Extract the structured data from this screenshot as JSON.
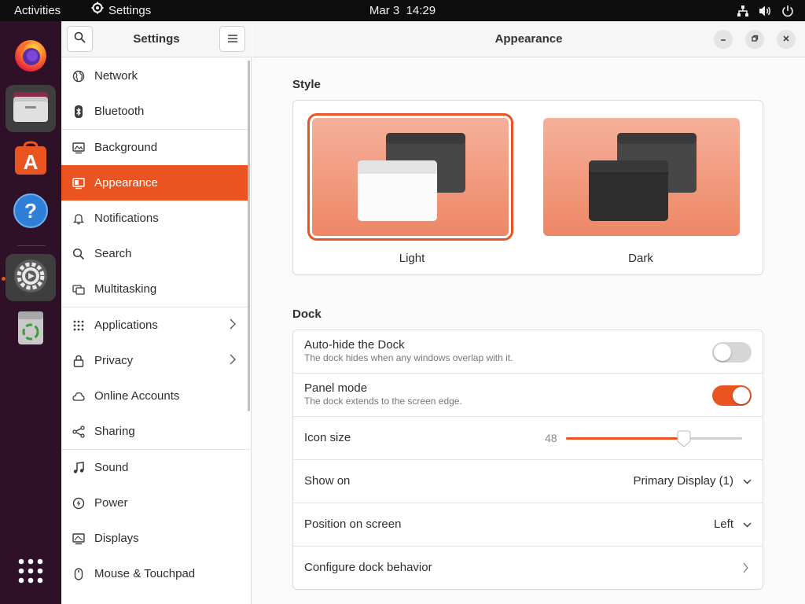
{
  "topbar": {
    "activities": "Activities",
    "app_name": "Settings",
    "date": "Mar 3",
    "time": "14:29"
  },
  "dock": {
    "items": [
      {
        "name": "Firefox Web Browser",
        "icon": "firefox-icon"
      },
      {
        "name": "Files",
        "icon": "files-icon"
      },
      {
        "name": "Ubuntu Software",
        "icon": "software-icon"
      },
      {
        "name": "Help",
        "icon": "help-icon"
      },
      {
        "name": "Settings",
        "icon": "settings-icon"
      },
      {
        "name": "Trash",
        "icon": "trash-icon"
      },
      {
        "name": "Show Applications",
        "icon": "app-grid-icon"
      }
    ]
  },
  "sidebar": {
    "title": "Settings",
    "items": [
      {
        "label": "Network",
        "icon": "globe-icon"
      },
      {
        "label": "Bluetooth",
        "icon": "bluetooth-icon"
      },
      {
        "label": "Background",
        "icon": "background-icon"
      },
      {
        "label": "Appearance",
        "icon": "appearance-icon",
        "selected": true
      },
      {
        "label": "Notifications",
        "icon": "bell-icon"
      },
      {
        "label": "Search",
        "icon": "search-icon"
      },
      {
        "label": "Multitasking",
        "icon": "multitasking-icon"
      },
      {
        "label": "Applications",
        "icon": "grid-icon",
        "has_submenu": true
      },
      {
        "label": "Privacy",
        "icon": "lock-icon",
        "has_submenu": true
      },
      {
        "label": "Online Accounts",
        "icon": "cloud-icon"
      },
      {
        "label": "Sharing",
        "icon": "share-icon"
      },
      {
        "label": "Sound",
        "icon": "music-note-icon"
      },
      {
        "label": "Power",
        "icon": "power-icon"
      },
      {
        "label": "Displays",
        "icon": "display-icon"
      },
      {
        "label": "Mouse & Touchpad",
        "icon": "mouse-icon"
      }
    ]
  },
  "main": {
    "title": "Appearance",
    "style": {
      "heading": "Style",
      "options": [
        {
          "label": "Light",
          "selected": true
        },
        {
          "label": "Dark",
          "selected": false
        }
      ]
    },
    "dock": {
      "heading": "Dock",
      "autohide": {
        "title": "Auto-hide the Dock",
        "subtitle": "The dock hides when any windows overlap with it.",
        "enabled": false
      },
      "panel_mode": {
        "title": "Panel mode",
        "subtitle": "The dock extends to the screen edge.",
        "enabled": true
      },
      "icon_size": {
        "title": "Icon size",
        "value": "48",
        "fraction": 0.67
      },
      "show_on": {
        "title": "Show on",
        "value": "Primary Display (1)"
      },
      "position": {
        "title": "Position on screen",
        "value": "Left"
      },
      "configure": {
        "title": "Configure dock behavior"
      }
    }
  },
  "colors": {
    "accent": "#e95420",
    "topbar": "#0e0e0e",
    "dock": "#2e1027"
  }
}
